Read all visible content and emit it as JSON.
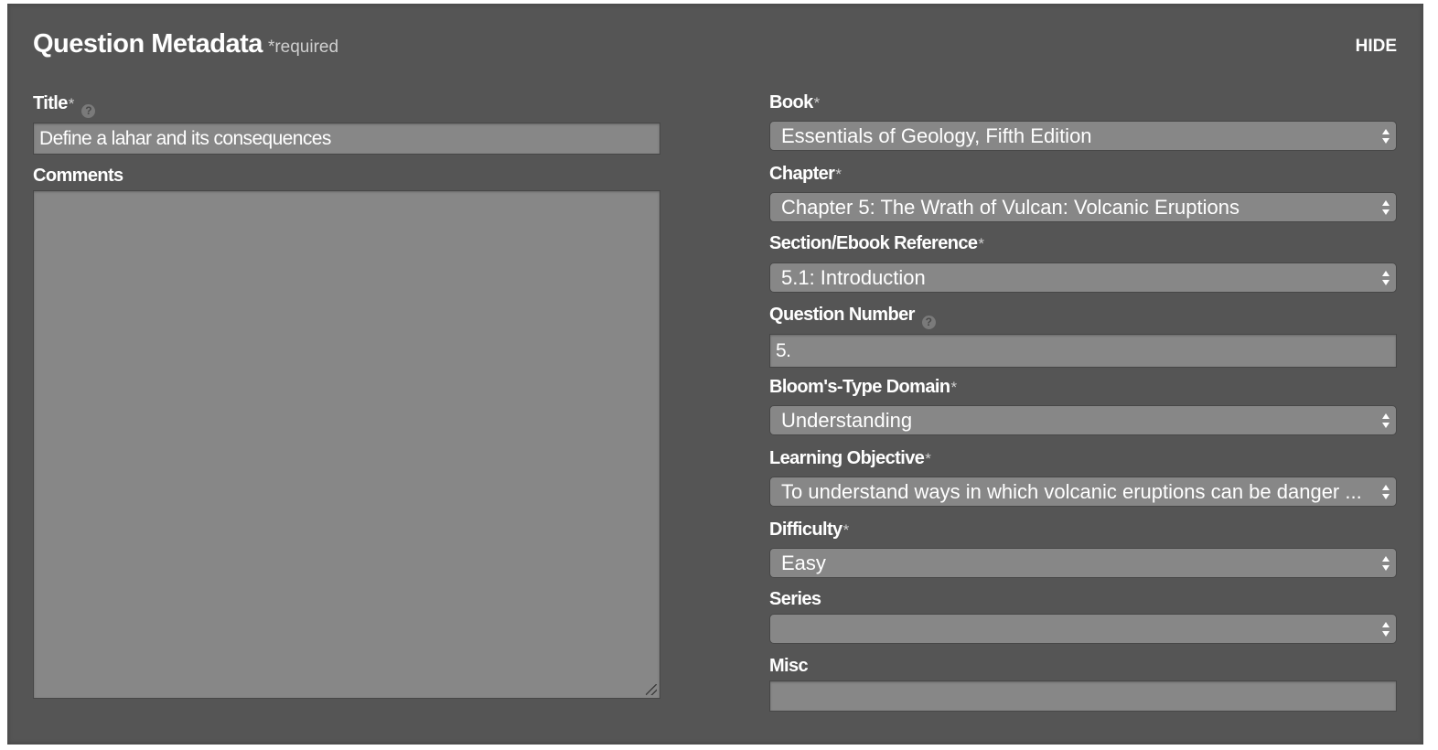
{
  "header": {
    "title": "Question Metadata",
    "required_note": "*required",
    "hide_label": "HIDE"
  },
  "left": {
    "title": {
      "label": "Title",
      "required": "*",
      "help_icon": "?",
      "value": "Define a lahar and its consequences"
    },
    "comments": {
      "label": "Comments",
      "value": ""
    }
  },
  "right": {
    "book": {
      "label": "Book",
      "required": "*",
      "value": "Essentials of Geology, Fifth Edition"
    },
    "chapter": {
      "label": "Chapter",
      "required": "*",
      "value": "Chapter 5: The Wrath of Vulcan: Volcanic Eruptions"
    },
    "section": {
      "label": "Section/Ebook Reference",
      "required": "*",
      "value": "5.1: Introduction"
    },
    "question_number": {
      "label": "Question Number",
      "help_icon": "?",
      "value": "5."
    },
    "blooms": {
      "label": "Bloom's-Type Domain",
      "required": "*",
      "value": "Understanding"
    },
    "objective": {
      "label": "Learning Objective",
      "required": "*",
      "value": "To understand ways in which volcanic eruptions can be danger ..."
    },
    "difficulty": {
      "label": "Difficulty",
      "required": "*",
      "value": "Easy"
    },
    "series": {
      "label": "Series",
      "value": ""
    },
    "misc": {
      "label": "Misc",
      "value": ""
    }
  },
  "colors": {
    "panel_bg": "#555555",
    "field_bg": "#878787",
    "text": "#ffffff"
  }
}
